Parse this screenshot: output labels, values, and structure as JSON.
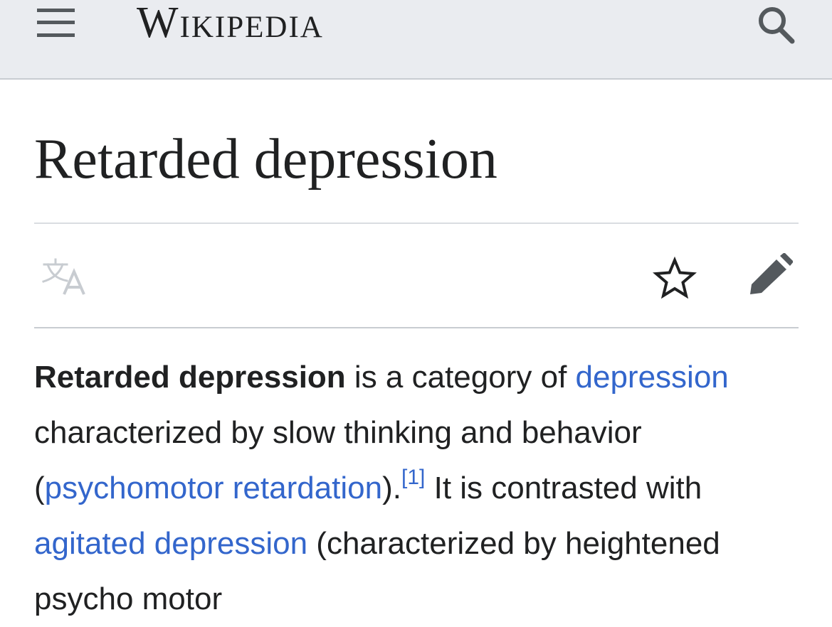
{
  "header": {
    "wordmark": "Wikipedia",
    "menu_icon": "hamburger-menu-icon",
    "search_icon": "search-icon",
    "background": "#eaecf0"
  },
  "article": {
    "title": "Retarded depression",
    "actions": {
      "language_icon": "language-icon",
      "watch_icon": "star-icon",
      "edit_icon": "pencil-icon"
    },
    "lead": {
      "bold_term": "Retarded depression",
      "text_1": " is a category of ",
      "link_1": "depression",
      "text_2": " characterized by slow thinking and behavior (",
      "link_2": "psychomotor retardation",
      "text_3": ").",
      "ref_1": "[1]",
      "text_4": " It is contrasted with ",
      "link_3": "agitated depression",
      "text_5": " (characterized by heightened psycho motor"
    }
  },
  "colors": {
    "link": "#3366cc",
    "text": "#202122",
    "icon": "#54595d"
  }
}
